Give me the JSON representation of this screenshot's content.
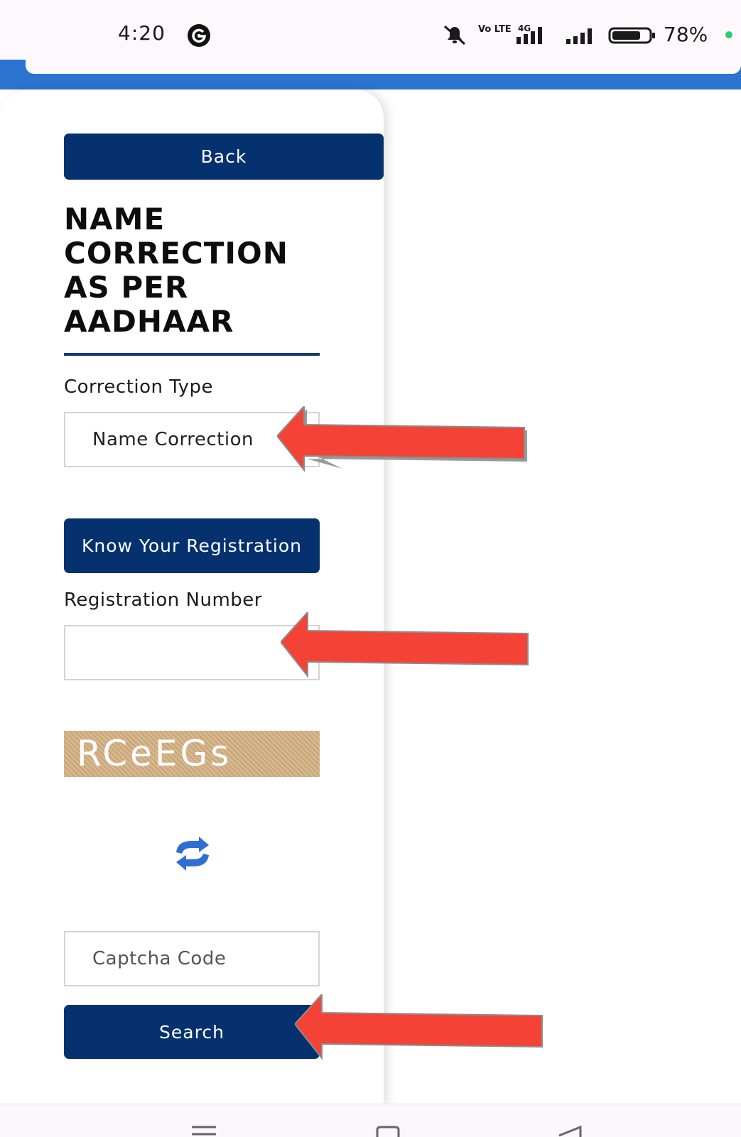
{
  "status_bar": {
    "time": "4:20",
    "battery_percent": "78%",
    "network_label": "4G",
    "volte_label": "Vo LTE",
    "battery_level": 0.78
  },
  "form": {
    "back_label": "Back",
    "title": "NAME CORRECTION AS PER AADHAAR",
    "correction_type_label": "Correction Type",
    "correction_type_value": "Name Correction",
    "know_registration_label": "Know Your Registration",
    "registration_number_label": "Registration Number",
    "registration_number_value": "",
    "captcha_text": "RCeEGs",
    "captcha_placeholder": "Captcha Code",
    "search_label": "Search"
  },
  "colors": {
    "primary_button": "#05326e",
    "header_band": "#2c74d0",
    "arrow": "#f44336"
  }
}
